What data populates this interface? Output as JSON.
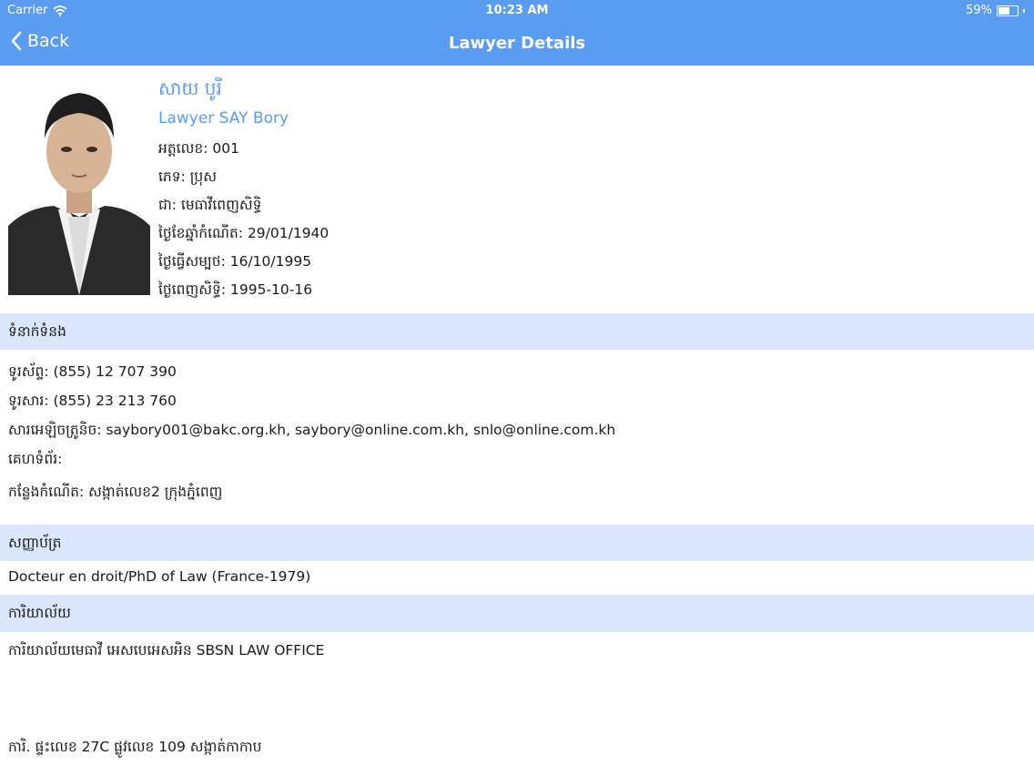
{
  "status_bar": {
    "carrier": "Carrier",
    "time": "10:23 AM",
    "battery": "59%",
    "battery_level": 0.59
  },
  "nav": {
    "back_label": "Back",
    "title": "Lawyer Details"
  },
  "profile": {
    "name_kh": "សាយ បូរី",
    "name_en": "Lawyer SAY Bory",
    "rows": [
      "អត្តលេខ: 001",
      "ភេទ: ប្រុស",
      "ជា: មេធាវីពេញសិទ្ធិ",
      "ថ្ងៃខែឆ្នាំកំណើត: 29/01/1940",
      "ថ្ងៃធ្វើសម្បថ: 16/10/1995",
      "ថ្ងៃពេញសិទ្ធិ: 1995-10-16"
    ]
  },
  "contact": {
    "header": "ទំនាក់ទំនង",
    "phone": "ទូរស័ព្ទ: (855) 12 707 390",
    "fax": "ទូរសារ: (855) 23 213 760",
    "email": "សារអេឡិចត្រូនិច: saybory001@bakc.org.kh, saybory@online.com.kh, snlo@online.com.kh",
    "website": "គេហទំព័រ:",
    "birthplace": "កន្លែងកំណើត: សង្កាត់លេខ2 ក្រុងភ្នំពេញ"
  },
  "degree": {
    "header": "សញ្ញាប័ត្រ",
    "value": "Docteur en droit/PhD of Law (France-1979)"
  },
  "office": {
    "header": "ការិយាល័យ",
    "name": "ការិយាល័យមេធាវី  អេសបេអេសអិន SBSN LAW OFFICE",
    "address": "ការិ. ផ្ទះលេខ 27C ផ្លូវលេខ 109  សង្កាត់កាកាប"
  },
  "colors": {
    "accent": "#5b9cf3",
    "section_bg": "#d9e6fb"
  },
  "icons": {
    "wifi": "wifi-icon",
    "battery": "battery-icon",
    "back": "chevron-left-icon"
  }
}
